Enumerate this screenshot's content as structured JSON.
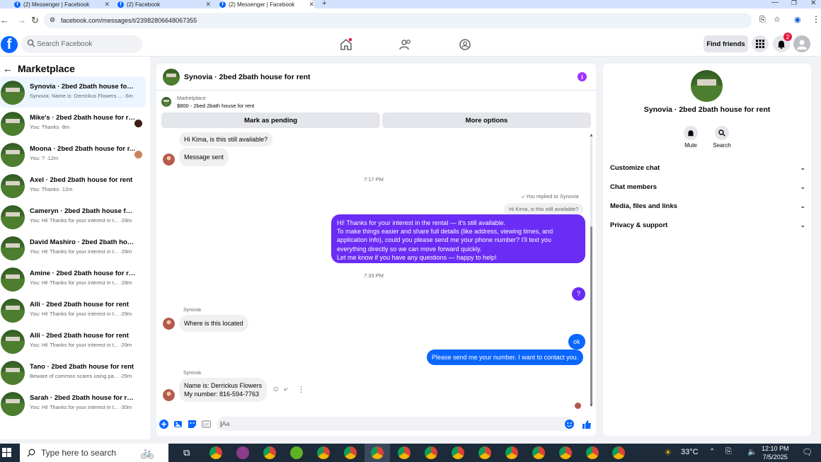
{
  "browser": {
    "tabs": [
      {
        "label": "(2) Messenger | Facebook",
        "active": false
      },
      {
        "label": "(2) Facebook",
        "active": false
      },
      {
        "label": "(2) Messenger | Facebook",
        "active": true
      }
    ],
    "url": "facebook.com/messages/t/23982806648067355"
  },
  "fb_header": {
    "search_placeholder": "Search Facebook",
    "find_friends": "Find friends",
    "notif_count": "2"
  },
  "marketplace": {
    "title": "Marketplace",
    "conversations": [
      {
        "title": "Synovia · 2bed 2bath house for rent",
        "subtitle": "Synovia: Name is: Derrickus Flowers ... ·6m",
        "selected": true
      },
      {
        "title": "Mike's · 2bed 2bath house for re...",
        "subtitle": "You: Thanks ·8m"
      },
      {
        "title": "Moona · 2bed 2bath house for r...",
        "subtitle": "You: ? ·12m"
      },
      {
        "title": "Axel · 2bed 2bath house for rent",
        "subtitle": "You: Thanks ·12m"
      },
      {
        "title": "Cameryn · 2bed 2bath house for r...",
        "subtitle": "You: Hi! Thanks for your interest in t... ·28m"
      },
      {
        "title": "David Mashiro · 2bed 2bath house...",
        "subtitle": "You: Hi! Thanks for your interest in t... ·28m"
      },
      {
        "title": "Amine · 2bed 2bath house for rent",
        "subtitle": "You: Hi! Thanks for your interest in t... ·28m"
      },
      {
        "title": "Alli · 2bed 2bath house for rent",
        "subtitle": "You: Hi! Thanks for your interest in t... ·29m"
      },
      {
        "title": "Alli · 2bed 2bath house for rent",
        "subtitle": "You: Hi! Thanks for your interest in t... ·29m"
      },
      {
        "title": "Tano · 2bed 2bath house for rent",
        "subtitle": "Beware of common scams using pa... ·29m"
      },
      {
        "title": "Sarah · 2bed 2bath house for rent",
        "subtitle": "You: Hi! Thanks for your interest in t... ·30m"
      }
    ]
  },
  "chat": {
    "title": "Synovia · 2bed 2bath house for rent",
    "listing_label": "Marketplace",
    "listing_desc": "$800 - 2bed 2bath house for rent",
    "mark_pending": "Mark as pending",
    "more_options": "More options",
    "msg_hi_kima": "Hi Kima, is this still available?",
    "msg_sent": "Message sent",
    "time1": "7:17 PM",
    "replied_to": "You replied to Synovia",
    "quoted": "Hi Kima, is this still available?",
    "long_reply": [
      "Hi! Thanks for your interest in the rental — it's still available.",
      "To make things easier and share full details (like address, viewing times, and",
      "application info), could you please send me your phone number? I'll text you",
      "everything directly so we can move forward quickly.",
      "Let me know if you have any questions — happy to help!"
    ],
    "time2": "7:33 PM",
    "q_mark": "?",
    "sender1": "Synovia",
    "where_located": "Where is this located",
    "ok": "ok",
    "send_number": "Please send me your number. I want to contact you.",
    "sender2": "Synovia",
    "name_line": "Name is: Derrickus Flowers",
    "number_line": "My number: 816-594-7763",
    "composer_placeholder": "Aa"
  },
  "right_panel": {
    "title": "Synovia · 2bed 2bath house for rent",
    "mute": "Mute",
    "search": "Search",
    "sections": [
      "Customize chat",
      "Chat members",
      "Media, files and links",
      "Privacy & support"
    ]
  },
  "taskbar": {
    "search_placeholder": "Type here to search",
    "weather": "33°C",
    "time": "12:10 PM",
    "date": "7/5/2025"
  },
  "colors": {
    "fb_blue": "#0866ff",
    "outgoing_purple": "#6b2cf5",
    "outgoing_blue": "#0a66ff",
    "notif_red": "#e41e3f"
  }
}
